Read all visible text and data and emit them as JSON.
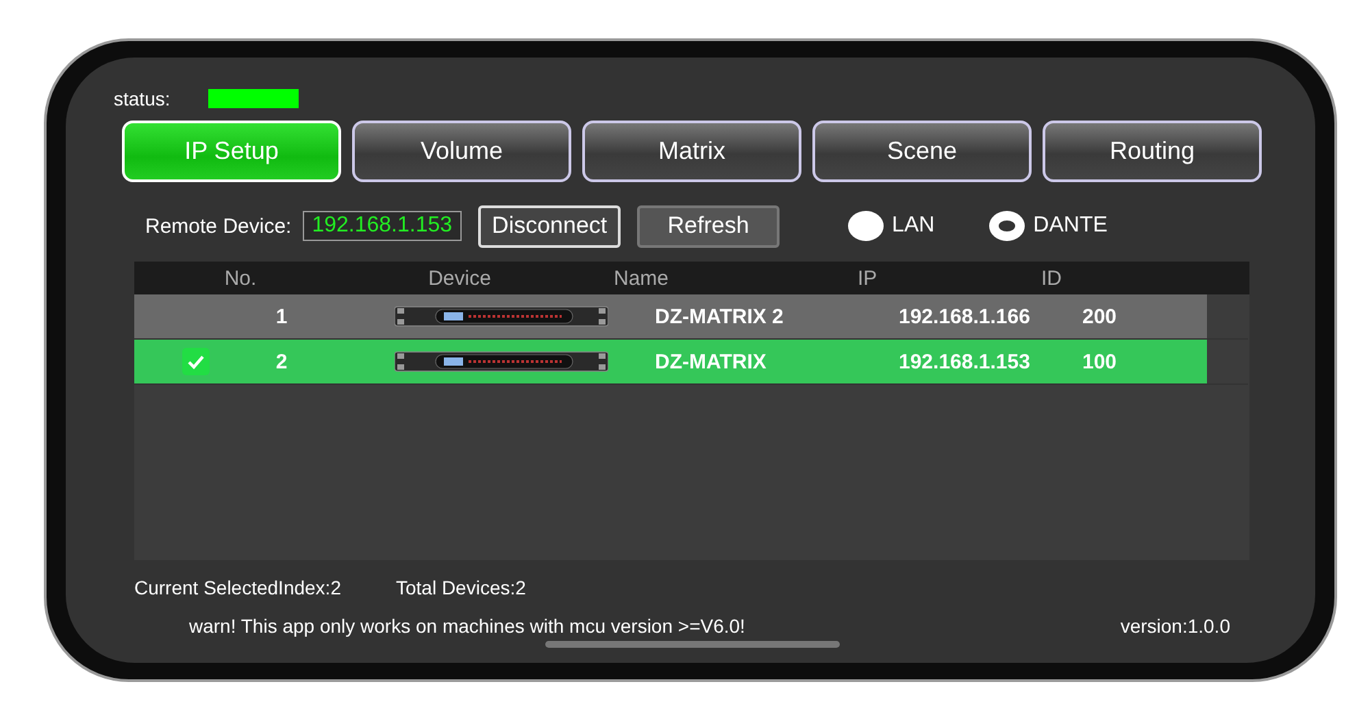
{
  "status": {
    "label": "status:",
    "color": "#00ff00"
  },
  "tabs": [
    {
      "label": "IP Setup",
      "selected": true
    },
    {
      "label": "Volume",
      "selected": false
    },
    {
      "label": "Matrix",
      "selected": false
    },
    {
      "label": "Scene",
      "selected": false
    },
    {
      "label": "Routing",
      "selected": false
    }
  ],
  "remote": {
    "label": "Remote Device:",
    "value": "192.168.1.153"
  },
  "buttons": [
    "Disconnect",
    "Refresh"
  ],
  "radios": [
    {
      "label": "LAN",
      "selected": false
    },
    {
      "label": "DANTE",
      "selected": true
    }
  ],
  "table": {
    "columns": [
      "No.",
      "Device",
      "Name",
      "IP",
      "ID"
    ],
    "rows": [
      {
        "no": "1",
        "name": "DZ-MATRIX 2",
        "ip": "192.168.1.166",
        "id": "200",
        "selected": false
      },
      {
        "no": "2",
        "name": "DZ-MATRIX",
        "ip": "192.168.1.153",
        "id": "100",
        "selected": true
      }
    ]
  },
  "footer": {
    "selected_index": "Current SelectedIndex:2",
    "total": "Total Devices:2",
    "warning": "warn! This app only works on machines with mcu version >=V6.0!",
    "version": "version:1.0.0"
  }
}
